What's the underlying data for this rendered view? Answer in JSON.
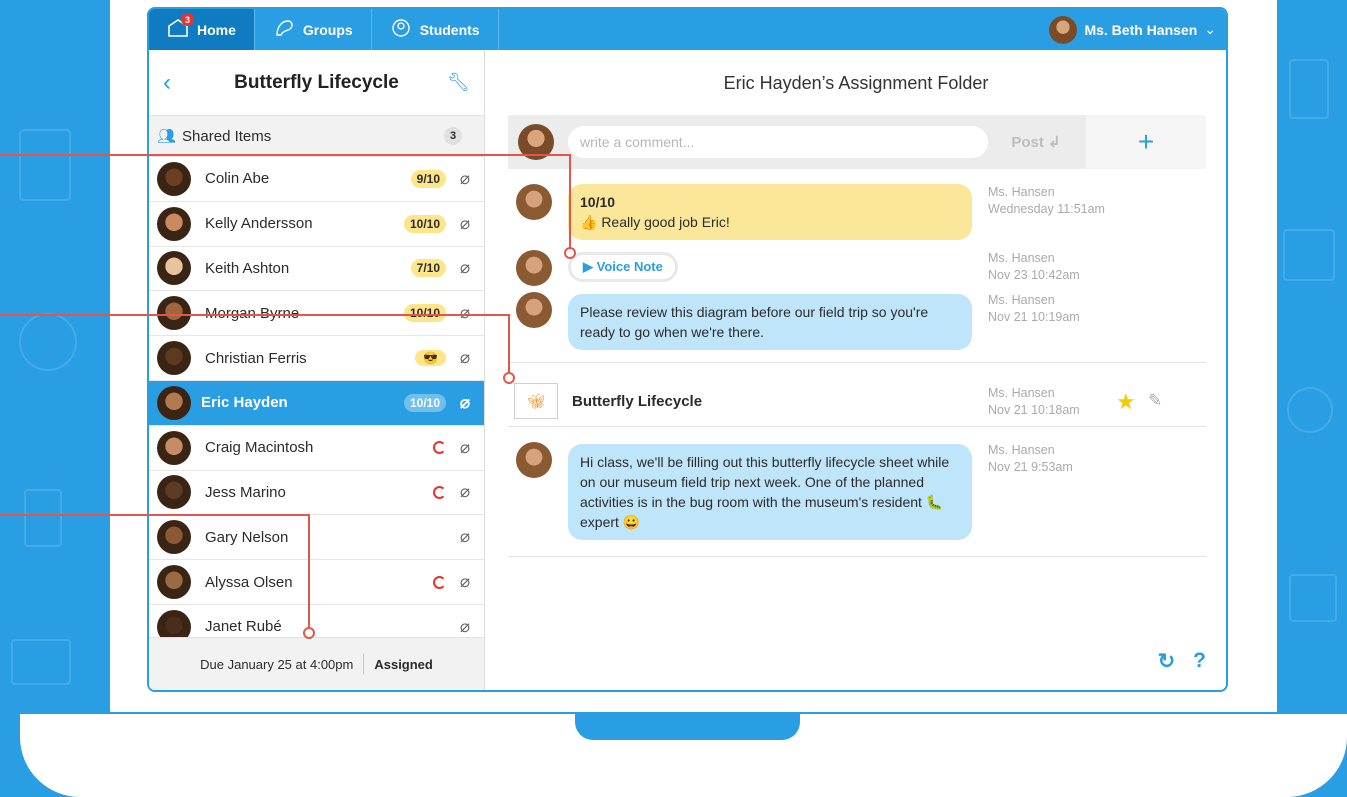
{
  "nav": {
    "tabs": [
      {
        "label": "Home",
        "icon": "home-icon",
        "badge": "3"
      },
      {
        "label": "Groups",
        "icon": "groups-icon"
      },
      {
        "label": "Students",
        "icon": "students-icon"
      }
    ],
    "user_name": "Ms. Beth Hansen"
  },
  "sidebar": {
    "title": "Butterfly Lifecycle",
    "shared_label": "Shared Items",
    "shared_count": "3",
    "students": [
      {
        "name": "Colin Abe",
        "status": "9/10"
      },
      {
        "name": "Kelly Andersson",
        "status": "10/10"
      },
      {
        "name": "Keith Ashton",
        "status": "7/10"
      },
      {
        "name": "Morgan Byrne",
        "status": "10/10"
      },
      {
        "name": "Christian Ferris",
        "status": "😎"
      },
      {
        "name": "Eric Hayden",
        "status": "10/10"
      },
      {
        "name": "Craig Macintosh",
        "status": ""
      },
      {
        "name": "Jess Marino",
        "status": ""
      },
      {
        "name": "Gary Nelson",
        "status": ""
      },
      {
        "name": "Alyssa Olsen",
        "status": ""
      },
      {
        "name": "Janet Rubé",
        "status": ""
      }
    ],
    "due_text": "Due January 25 at 4:00pm",
    "assigned_label": "Assigned"
  },
  "main": {
    "title": "Eric Hayden’s Assignment Folder",
    "comment_placeholder": "write a comment...",
    "post_label": "Post",
    "messages": [
      {
        "grade": "10/10",
        "text": "👍 Really good job Eric!",
        "author": "Ms. Hansen",
        "time": "Wednesday 11:51am"
      },
      {
        "text": "▶ Voice Note",
        "author": "Ms. Hansen",
        "time": "Nov 23 10:42am"
      },
      {
        "text": "Please review this diagram before our field trip so you're ready to go when we're there.",
        "author": "Ms. Hansen",
        "time": "Nov 21 10:19am"
      },
      {
        "text": "Butterfly Lifecycle",
        "author": "Ms. Hansen",
        "time": "Nov 21 10:18am"
      },
      {
        "text": "Hi class, we'll be filling out this butterfly lifecycle sheet while on our museum field trip next week. One of the planned activities is in the bug room with the museum's resident 🐛 expert 😀",
        "author": "Ms. Hansen",
        "time": "Nov 21 9:53am"
      }
    ],
    "help_label": "?"
  },
  "colors": {
    "brand_blue": "#2a9ee2",
    "selected_blue": "#0f7cc1",
    "grade_yellow": "#fde58a",
    "callout_red": "#e5564a"
  }
}
